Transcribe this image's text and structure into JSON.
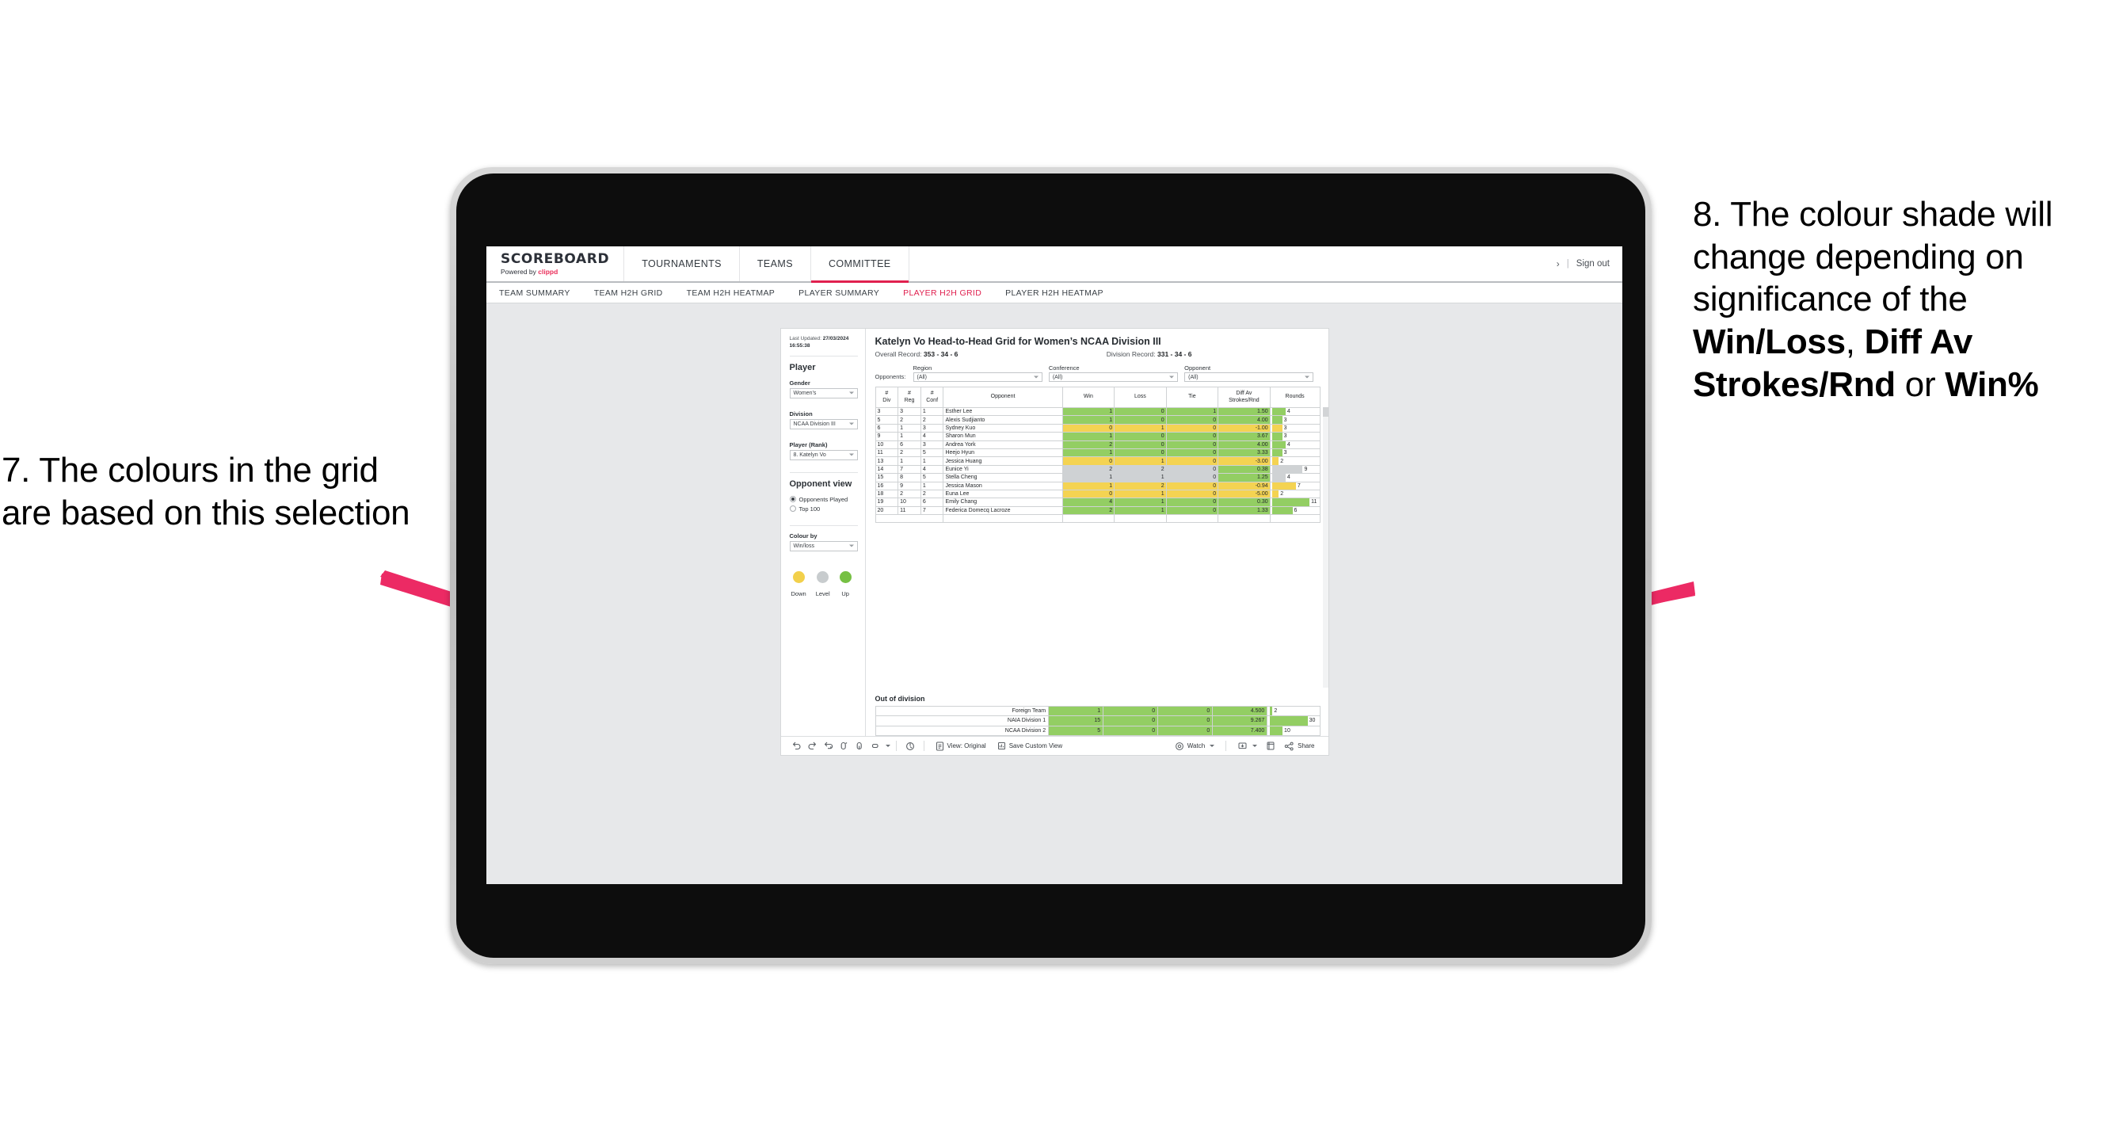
{
  "annotations": {
    "left": {
      "id": "7.",
      "text": "7. The colours in the grid are based on this selection"
    },
    "right": {
      "id": "8.",
      "line1": "8. The colour shade will change depending on significance of the ",
      "bold1": "Win/Loss",
      "sep1": ", ",
      "bold2": "Diff Av Strokes/Rnd",
      "sep2": " or ",
      "bold3": "Win%"
    },
    "arrow_color": "#ec2a64"
  },
  "header": {
    "brand_name": "SCOREBOARD",
    "brand_sub_prefix": "Powered by ",
    "brand_sub_accent": "clippd",
    "nav": [
      {
        "label": "TOURNAMENTS",
        "active": false
      },
      {
        "label": "TEAMS",
        "active": false
      },
      {
        "label": "COMMITTEE",
        "active": true
      }
    ],
    "chevron_icon": "›",
    "divider": "|",
    "sign_out": "Sign out",
    "accent_color": "#e0204f"
  },
  "subnav": [
    {
      "label": "TEAM SUMMARY",
      "active": false
    },
    {
      "label": "TEAM H2H GRID",
      "active": false
    },
    {
      "label": "TEAM H2H HEATMAP",
      "active": false
    },
    {
      "label": "PLAYER SUMMARY",
      "active": false
    },
    {
      "label": "PLAYER H2H GRID",
      "active": true
    },
    {
      "label": "PLAYER H2H HEATMAP",
      "active": false
    }
  ],
  "sidebar": {
    "last_updated_label": "Last Updated: ",
    "last_updated_value": "27/03/2024 16:55:38",
    "player_heading": "Player",
    "filters": [
      {
        "label": "Gender",
        "value": "Women’s"
      },
      {
        "label": "Division",
        "value": "NCAA Division III"
      },
      {
        "label": "Player (Rank)",
        "value": "8. Katelyn Vo"
      }
    ],
    "opponent_view_heading": "Opponent view",
    "opponent_view_options": [
      {
        "label": "Opponents Played",
        "selected": true
      },
      {
        "label": "Top 100",
        "selected": false
      }
    ],
    "colour_by_label": "Colour by",
    "colour_by_value": "Win/loss",
    "legend": [
      {
        "label": "Down",
        "color": "#f2d04b"
      },
      {
        "label": "Level",
        "color": "#c8ccce"
      },
      {
        "label": "Up",
        "color": "#76c043"
      }
    ]
  },
  "main": {
    "title": "Katelyn Vo Head-to-Head Grid for Women’s NCAA Division III",
    "overall_record_label": "Overall Record: ",
    "overall_record_value": "353 - 34 - 6",
    "division_record_label": "Division Record: ",
    "division_record_value": "331 - 34 - 6",
    "opponents_label": "Opponents:",
    "opponent_filters": [
      {
        "label": "Region",
        "value": "(All)"
      },
      {
        "label": "Conference",
        "value": "(All)"
      },
      {
        "label": "Opponent",
        "value": "(All)"
      }
    ],
    "columns": [
      {
        "l1": "#",
        "l2": "Div"
      },
      {
        "l1": "#",
        "l2": "Reg"
      },
      {
        "l1": "#",
        "l2": "Conf"
      },
      {
        "l1": "Opponent",
        "l2": ""
      },
      {
        "l1": "Win",
        "l2": ""
      },
      {
        "l1": "Loss",
        "l2": ""
      },
      {
        "l1": "Tie",
        "l2": ""
      },
      {
        "l1": "Diff Av",
        "l2": "Strokes/Rnd"
      },
      {
        "l1": "Rounds",
        "l2": ""
      }
    ],
    "rows": [
      {
        "div": "3",
        "reg": "3",
        "conf": "1",
        "opponent": "Esther Lee",
        "win": "1",
        "loss": "0",
        "tie": "1",
        "diff": "1.50",
        "rounds": "4",
        "shade": "green"
      },
      {
        "div": "5",
        "reg": "2",
        "conf": "2",
        "opponent": "Alexis Sudjianto",
        "win": "1",
        "loss": "0",
        "tie": "0",
        "diff": "4.00",
        "rounds": "3",
        "shade": "green"
      },
      {
        "div": "6",
        "reg": "1",
        "conf": "3",
        "opponent": "Sydney Kuo",
        "win": "0",
        "loss": "1",
        "tie": "0",
        "diff": "-1.00",
        "rounds": "3",
        "shade": "yellow"
      },
      {
        "div": "9",
        "reg": "1",
        "conf": "4",
        "opponent": "Sharon Mun",
        "win": "1",
        "loss": "0",
        "tie": "0",
        "diff": "3.67",
        "rounds": "3",
        "shade": "green"
      },
      {
        "div": "10",
        "reg": "6",
        "conf": "3",
        "opponent": "Andrea York",
        "win": "2",
        "loss": "0",
        "tie": "0",
        "diff": "4.00",
        "rounds": "4",
        "shade": "green"
      },
      {
        "div": "11",
        "reg": "2",
        "conf": "5",
        "opponent": "Heejo Hyun",
        "win": "1",
        "loss": "0",
        "tie": "0",
        "diff": "3.33",
        "rounds": "3",
        "shade": "green"
      },
      {
        "div": "13",
        "reg": "1",
        "conf": "1",
        "opponent": "Jessica Huang",
        "win": "0",
        "loss": "1",
        "tie": "0",
        "diff": "-3.00",
        "rounds": "2",
        "shade": "yellow"
      },
      {
        "div": "14",
        "reg": "7",
        "conf": "4",
        "opponent": "Eunice Yi",
        "win": "2",
        "loss": "2",
        "tie": "0",
        "diff": "0.38",
        "rounds": "9",
        "shade": "grey"
      },
      {
        "div": "15",
        "reg": "8",
        "conf": "5",
        "opponent": "Stella Cheng",
        "win": "1",
        "loss": "1",
        "tie": "0",
        "diff": "1.25",
        "rounds": "4",
        "shade": "grey"
      },
      {
        "div": "16",
        "reg": "9",
        "conf": "1",
        "opponent": "Jessica Mason",
        "win": "1",
        "loss": "2",
        "tie": "0",
        "diff": "-0.94",
        "rounds": "7",
        "shade": "yellow"
      },
      {
        "div": "18",
        "reg": "2",
        "conf": "2",
        "opponent": "Euna Lee",
        "win": "0",
        "loss": "1",
        "tie": "0",
        "diff": "-5.00",
        "rounds": "2",
        "shade": "yellow"
      },
      {
        "div": "19",
        "reg": "10",
        "conf": "6",
        "opponent": "Emily Chang",
        "win": "4",
        "loss": "1",
        "tie": "0",
        "diff": "0.30",
        "rounds": "11",
        "shade": "green"
      },
      {
        "div": "20",
        "reg": "11",
        "conf": "7",
        "opponent": "Federica Domecq Lacroze",
        "win": "2",
        "loss": "1",
        "tie": "0",
        "diff": "1.33",
        "rounds": "6",
        "shade": "green"
      }
    ],
    "out_of_division_heading": "Out of division",
    "out_of_division_rows": [
      {
        "name": "Foreign Team",
        "win": "1",
        "loss": "0",
        "tie": "0",
        "diff": "4.500",
        "rounds": "2",
        "shade": "green"
      },
      {
        "name": "NAIA Division 1",
        "win": "15",
        "loss": "0",
        "tie": "0",
        "diff": "9.267",
        "rounds": "30",
        "shade": "green"
      },
      {
        "name": "NCAA Division 2",
        "win": "5",
        "loss": "0",
        "tie": "0",
        "diff": "7.400",
        "rounds": "10",
        "shade": "green"
      }
    ]
  },
  "toolbar": {
    "icons": [
      "undo-icon",
      "redo-icon",
      "revert-icon",
      "refresh-icon",
      "pause-icon",
      "resize-icon"
    ],
    "view_original_label": "View: Original",
    "save_custom_view_label": "Save Custom View",
    "watch_label": "Watch",
    "share_label": "Share",
    "download_icon": "download-icon",
    "fullscreen_icon": "fullscreen-icon",
    "alerts_icon": "alerts-icon",
    "view_icon": "view-icon",
    "save_icon": "save-icon",
    "watch_icon": "watch-icon",
    "share_icon": "share-icon"
  }
}
